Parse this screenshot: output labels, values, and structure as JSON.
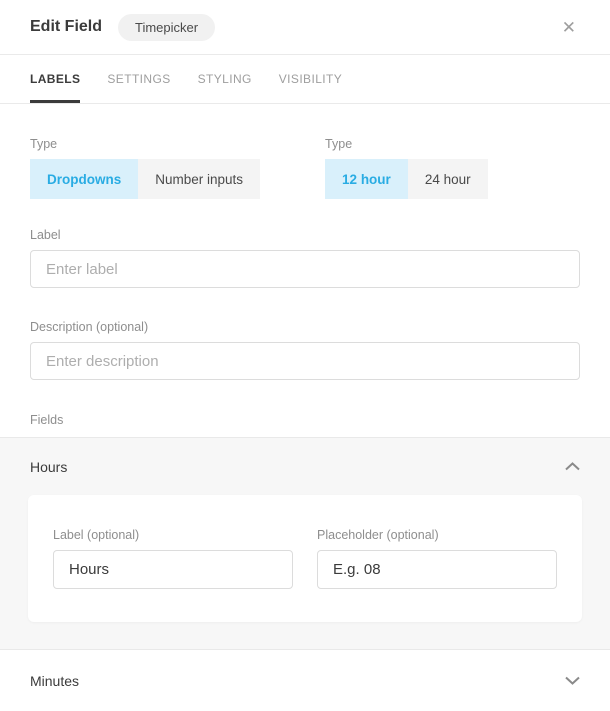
{
  "header": {
    "title": "Edit Field",
    "badge": "Timepicker",
    "close_glyph": "✕"
  },
  "tabs": {
    "items": [
      {
        "label": "LABELS",
        "active": true
      },
      {
        "label": "SETTINGS",
        "active": false
      },
      {
        "label": "STYLING",
        "active": false
      },
      {
        "label": "VISIBILITY",
        "active": false
      }
    ]
  },
  "form": {
    "picker_type": {
      "label": "Type",
      "options": [
        {
          "label": "Dropdowns",
          "selected": true
        },
        {
          "label": "Number inputs",
          "selected": false
        }
      ]
    },
    "hour_format": {
      "label": "Type",
      "options": [
        {
          "label": "12 hour",
          "selected": true
        },
        {
          "label": "24 hour",
          "selected": false
        }
      ]
    },
    "label_field": {
      "label": "Label",
      "placeholder": "Enter label",
      "value": ""
    },
    "description_field": {
      "label": "Description (optional)",
      "placeholder": "Enter description",
      "value": ""
    },
    "fields_label": "Fields"
  },
  "sections": {
    "hours": {
      "title": "Hours",
      "expanded": true,
      "label_field": {
        "label": "Label (optional)",
        "value": "Hours"
      },
      "placeholder_field": {
        "label": "Placeholder (optional)",
        "value": "E.g. 08"
      }
    },
    "minutes": {
      "title": "Minutes",
      "expanded": false
    }
  },
  "colors": {
    "accent": "#29ace3",
    "accent_bg": "#d9f0fb",
    "section_bg": "#f7f7f7"
  }
}
